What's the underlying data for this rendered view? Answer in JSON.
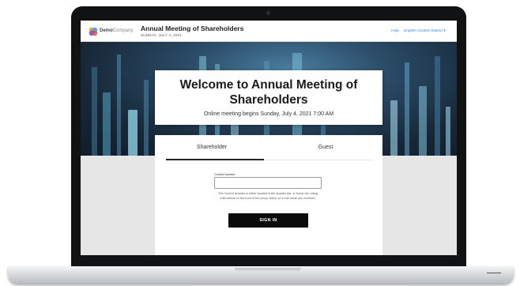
{
  "header": {
    "logo_icon": "democompany-logo-icon",
    "logo_brand": "Demo",
    "logo_suffix": "Company",
    "title": "Annual Meeting of Shareholders",
    "date": "SUNDAY, JULY 4, 2021",
    "help_label": "Help",
    "language_label": "English (United States) ▾"
  },
  "welcome": {
    "title": "Welcome to Annual Meeting of Shareholders",
    "subtitle": "Online meeting begins Sunday, July 4, 2021 7:00 AM"
  },
  "login": {
    "tabs": [
      {
        "label": "Shareholder",
        "active": true
      },
      {
        "label": "Guest",
        "active": false
      }
    ],
    "control_number_label": "Control Number",
    "control_number_value": "",
    "control_number_placeholder": "",
    "help_text": "The Control Number is either located in the shaded bar, or below the voting instructions on the front of the proxy notice, or in the email you received.",
    "signin_label": "SIGN IN"
  },
  "colors": {
    "accent_link": "#3a86d8",
    "button": "#0b0b0b",
    "hero_dark": "#182838"
  }
}
